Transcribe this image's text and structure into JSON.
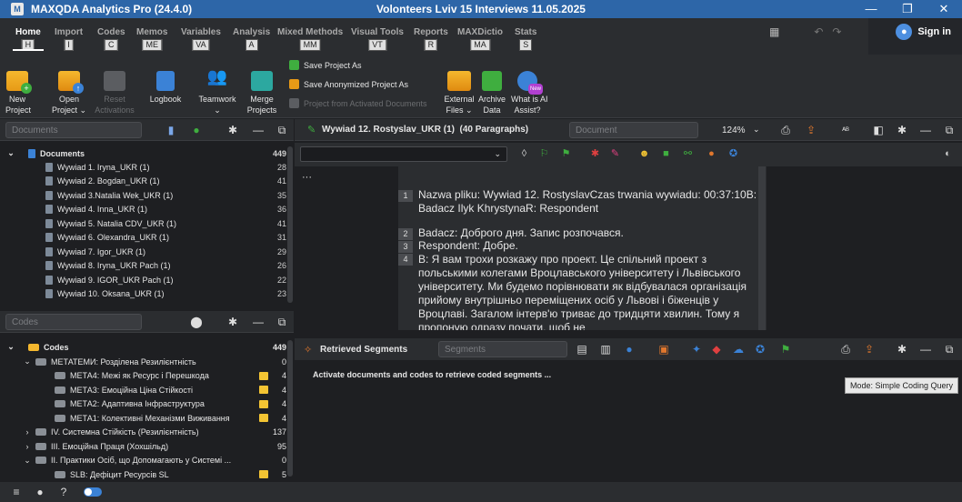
{
  "app": {
    "title": "MAXQDA Analytics Pro (24.4.0)",
    "document_title": "Volonteers Lviv 15 Interviews 11.05.2025",
    "sign_in": "Sign in"
  },
  "tabs": [
    {
      "label": "Home",
      "key": "H"
    },
    {
      "label": "Import",
      "key": "I"
    },
    {
      "label": "Codes",
      "key": "C"
    },
    {
      "label": "Memos",
      "key": "ME"
    },
    {
      "label": "Variables",
      "key": "VA"
    },
    {
      "label": "Analysis",
      "key": "A"
    },
    {
      "label": "Mixed Methods",
      "key": "MM"
    },
    {
      "label": "Visual Tools",
      "key": "VT"
    },
    {
      "label": "Reports",
      "key": "R"
    },
    {
      "label": "MAXDictio",
      "key": "MA"
    },
    {
      "label": "Stats",
      "key": "S"
    }
  ],
  "ribbon": {
    "new_project": "New\nProject",
    "open_project": "Open\nProject ⌄",
    "reset_activations": "Reset\nActivations",
    "logbook": "Logbook",
    "teamwork": "Teamwork\n⌄",
    "merge_projects": "Merge\nProjects",
    "save_project_as": "Save Project As",
    "save_anonymized": "Save Anonymized Project As",
    "project_from_activated": "Project from Activated Documents",
    "external_files": "External\nFiles ⌄",
    "archive_data": "Archive\nData",
    "what_is_ai": "What is AI\nAssist?",
    "new_badge": "New"
  },
  "documents": {
    "search_placeholder": "Documents",
    "root_label": "Documents",
    "root_count": "449",
    "items": [
      {
        "label": "Wywiad 1. Iryna_UKR (1)",
        "count": "28"
      },
      {
        "label": "Wywiad 2. Bogdan_UKR (1)",
        "count": "41"
      },
      {
        "label": "Wywiad 3.Natalia Wek_UKR (1)",
        "count": "35"
      },
      {
        "label": "Wywiad 4. Inna_UKR (1)",
        "count": "36"
      },
      {
        "label": "Wywiad 5. Natalia CDV_UKR (1)",
        "count": "41"
      },
      {
        "label": "Wywiad 6. Olexandra_UKR (1)",
        "count": "31"
      },
      {
        "label": "Wywiad 7. Igor_UKR (1)",
        "count": "29"
      },
      {
        "label": "Wywiad 8. Iryna_UKR Pach (1)",
        "count": "26"
      },
      {
        "label": "Wywiad 9. IGOR_UKR Pach (1)",
        "count": "22"
      },
      {
        "label": "Wywiad 10. Oksana_UKR (1)",
        "count": "23"
      }
    ]
  },
  "codes": {
    "search_placeholder": "Codes",
    "root_label": "Codes",
    "root_count": "449",
    "items": [
      {
        "label": "МЕТАТЕМИ: Розділена Резилієнтність",
        "count": "0",
        "level": 1,
        "chev": "⌄",
        "color": "#8a8f96",
        "memo": false
      },
      {
        "label": "МЕТА4: Межі як Ресурс і Перешкода",
        "count": "4",
        "level": 2,
        "chev": "",
        "color": "#8a8f96",
        "memo": true
      },
      {
        "label": "МЕТА3: Емоційна Ціна Стійкості",
        "count": "4",
        "level": 2,
        "chev": "",
        "color": "#8a8f96",
        "memo": true
      },
      {
        "label": "МЕТА2: Адаптивна Інфраструктура",
        "count": "4",
        "level": 2,
        "chev": "",
        "color": "#8a8f96",
        "memo": true
      },
      {
        "label": "МЕТА1: Колективні Механізми Виживання",
        "count": "4",
        "level": 2,
        "chev": "",
        "color": "#8a8f96",
        "memo": true
      },
      {
        "label": "IV. Системна Стійкість (Резилієнтність)",
        "count": "137",
        "level": 1,
        "chev": "›",
        "color": "#8a8f96",
        "memo": false
      },
      {
        "label": "III. Емоційна Праця (Хохшільд)",
        "count": "95",
        "level": 1,
        "chev": "›",
        "color": "#8a8f96",
        "memo": false
      },
      {
        "label": "II. Практики Осіб, що Допомагають у Системі ...",
        "count": "0",
        "level": 1,
        "chev": "⌄",
        "color": "#8a8f96",
        "memo": false
      },
      {
        "label": "SLB: Дефіцит Ресурсів SL",
        "count": "5",
        "level": 2,
        "chev": "",
        "color": "#8a8f96",
        "memo": true
      }
    ]
  },
  "viewer": {
    "title": "Wywiad 12. Rostyslav_UKR (1)  (40 Paragraphs)",
    "search_placeholder": "Document",
    "zoom": "124%",
    "paragraphs": [
      {
        "num": "1",
        "text": "Nazwa pliku: Wywiad 12. RostyslavCzas trwania wywiadu: 00:37:10B: Badacz  Ilyk KhrystynaR: Respondent"
      },
      {
        "num": "2",
        "text": "Badacz: Доброго дня. Запис розпочався."
      },
      {
        "num": "3",
        "text": "Respondent: Добре."
      },
      {
        "num": "4",
        "text": "B: Я вам трохи розкажу про проект. Це спільний проект з польськими колегами Вроцлавського університету і Львівського університету. Ми будемо порівнювати як відбувалася організація прийому внутрішньо переміщених осіб у Львові і біженців у Вроцлаві. Загалом інтерв'ю триває до тридцяти хвилин. Тому я пропоную одразу почати, щоб не"
      }
    ]
  },
  "segments": {
    "title": "Retrieved Segments",
    "search_placeholder": "Segments",
    "message": "Activate documents and codes to retrieve coded segments ...",
    "tooltip": "Mode: Simple Coding Query"
  },
  "colors": {
    "accent": "#2d66a8",
    "panel_bg": "#2b2d30",
    "body_bg": "#1e1f22"
  }
}
